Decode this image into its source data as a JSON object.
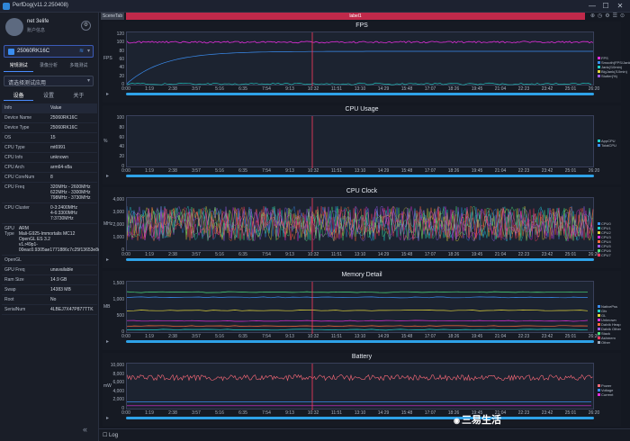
{
  "titlebar": {
    "title": "PerfDog(v11.2.250408)",
    "minimize": "—",
    "maximize": "☐",
    "close": "✕"
  },
  "user": {
    "name": "net 3elife",
    "status": "账户信息"
  },
  "device": {
    "name": "25060RK16C"
  },
  "modes": [
    "常规测试",
    "录像分析",
    "多端测试"
  ],
  "app_placeholder": "请选择测试应用",
  "info_tabs": [
    "设备",
    "设置",
    "关于"
  ],
  "info_table": {
    "headers": [
      "Info",
      "Value"
    ],
    "rows": [
      [
        "Device Name",
        "25060RK16C"
      ],
      [
        "Device Type",
        "25060RK16C"
      ],
      [
        "OS",
        "15"
      ],
      [
        "CPU Type",
        "mt6991"
      ],
      [
        "CPU Info",
        "unknown"
      ],
      [
        "CPU Arch",
        "arm64-v8a"
      ],
      [
        "CPU CoreNum",
        "8"
      ],
      [
        "CPU Freq",
        "320MHz - 2600MHz\n622MHz - 3300MHz\n798MHz - 3730MHz"
      ],
      [
        "CPU Cluster",
        "0-3:2400MHz\n4-6:3300MHz\n7:3730MHz"
      ],
      [
        "GPU Type",
        "ARM\nMali-G925-Immortalis MC12\nOpenGL ES 3.2\nv1.r49p1-00eac0.9305ae1771886c7c25f13653e8ca8ff7"
      ],
      [
        "OpenGL",
        ""
      ],
      [
        "GPU Freq",
        "unavailable"
      ],
      [
        "Ram Size",
        "14.9 GB"
      ],
      [
        "Swap",
        "14383 MB"
      ],
      [
        "Root",
        "No"
      ],
      [
        "SerialNum",
        "4LBEJ7X47P877TTK"
      ]
    ]
  },
  "toolbar": {
    "scene": "SceneTab",
    "label": "label1"
  },
  "x_ticks": [
    "0:00",
    "1:19",
    "2:38",
    "3:57",
    "5:16",
    "6:35",
    "7:54",
    "9:13",
    "10:32",
    "11:51",
    "13:10",
    "14:29",
    "15:48",
    "17:07",
    "18:26",
    "19:45",
    "21:04",
    "22:23",
    "23:42",
    "25:01",
    "26:20"
  ],
  "panels": {
    "fps": {
      "title": "FPS",
      "ylabel": "FPS",
      "yticks": [
        "120",
        "100",
        "80",
        "60",
        "40",
        "20",
        "0"
      ],
      "legend": [
        {
          "label": "FPS",
          "color": "#e02ed9"
        },
        {
          "label": "Smooth(FPS/Jank)",
          "color": "#3a8df0"
        },
        {
          "label": "Jank(/10min)",
          "color": "#1fd0c8"
        },
        {
          "label": "BigJank(/10min)",
          "color": "#e0d33a"
        },
        {
          "label": "Stutter(%)",
          "color": "#9b5cf0"
        }
      ]
    },
    "cpu_usage": {
      "title": "CPU Usage",
      "ylabel": "%",
      "yticks": [
        "100",
        "80",
        "60",
        "40",
        "20",
        "0"
      ],
      "legend": [
        {
          "label": "AppCPU",
          "color": "#1fd0c8"
        },
        {
          "label": "TotalCPU",
          "color": "#3a8df0"
        }
      ]
    },
    "cpu_clock": {
      "title": "CPU Clock",
      "ylabel": "MHz",
      "yticks": [
        "4,000",
        "3,000",
        "2,000",
        "1,000",
        "0"
      ],
      "legend": [
        {
          "label": "CPU0",
          "color": "#3a8df0"
        },
        {
          "label": "CPU1",
          "color": "#1fd0c8"
        },
        {
          "label": "CPU2",
          "color": "#e0d33a"
        },
        {
          "label": "CPU3",
          "color": "#e02ed9"
        },
        {
          "label": "CPU4",
          "color": "#ff6b3a"
        },
        {
          "label": "CPU5",
          "color": "#9b5cf0"
        },
        {
          "label": "CPU6",
          "color": "#4ce07a"
        },
        {
          "label": "CPU7",
          "color": "#ff3a5e"
        }
      ]
    },
    "memory": {
      "title": "Memory Detail",
      "ylabel": "MB",
      "yticks": [
        "1,500",
        "1,000",
        "500",
        "0"
      ],
      "legend": [
        {
          "label": "NativePss",
          "color": "#3a8df0"
        },
        {
          "label": "Gfx",
          "color": "#1fd0c8"
        },
        {
          "label": "GL",
          "color": "#e0d33a"
        },
        {
          "label": "Unknown",
          "color": "#e02ed9"
        },
        {
          "label": "Dalvik Heap",
          "color": "#ff6b3a"
        },
        {
          "label": "Dalvik Other",
          "color": "#9b5cf0"
        },
        {
          "label": "Stack",
          "color": "#4ce07a"
        },
        {
          "label": "Ashmem",
          "color": "#ff3a5e"
        },
        {
          "label": "Other",
          "color": "#a0a8b8"
        }
      ]
    },
    "battery": {
      "title": "Battery",
      "ylabel": "mW",
      "yticks": [
        "10,000",
        "8,000",
        "6,000",
        "4,000",
        "2,000",
        "0"
      ],
      "legend": [
        {
          "label": "Power",
          "color": "#ff6b7a"
        },
        {
          "label": "Voltage",
          "color": "#3a8df0"
        },
        {
          "label": "Current",
          "color": "#e02ed9"
        }
      ]
    }
  },
  "chart_data": [
    {
      "type": "line",
      "title": "FPS",
      "ylabel": "FPS",
      "ylim": [
        0,
        120
      ],
      "series": [
        {
          "name": "FPS",
          "values": [
            62,
            60,
            61,
            60,
            60,
            61,
            60,
            60,
            60,
            61,
            60,
            60
          ]
        }
      ]
    },
    {
      "type": "line",
      "title": "CPU Usage",
      "ylabel": "%",
      "ylim": [
        0,
        100
      ],
      "series": []
    },
    {
      "type": "area",
      "title": "CPU Clock",
      "ylabel": "MHz",
      "ylim": [
        0,
        4000
      ],
      "series": []
    },
    {
      "type": "line",
      "title": "Memory Detail",
      "ylabel": "MB",
      "ylim": [
        0,
        1500
      ],
      "series": []
    },
    {
      "type": "line",
      "title": "Battery",
      "ylabel": "mW",
      "ylim": [
        0,
        10000
      ],
      "series": [
        {
          "name": "Power",
          "values": [
            7200,
            7400,
            7100,
            7300,
            7200,
            7400,
            7300,
            7200,
            7300,
            7400,
            7200,
            7300
          ]
        }
      ]
    }
  ],
  "bottom": {
    "log_label": "Log"
  },
  "watermark": {
    "text": "三易生活"
  }
}
